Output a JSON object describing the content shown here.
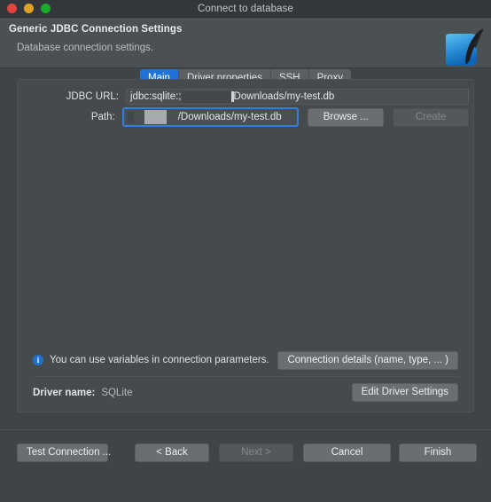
{
  "window": {
    "title": "Connect to database",
    "traffic_lights": [
      "close-red",
      "minimize-yellow",
      "zoom-green"
    ]
  },
  "header": {
    "title": "Generic JDBC Connection Settings",
    "subtitle": "Database connection settings.",
    "logo_icon": "sqlite-logo-icon"
  },
  "tabs": [
    {
      "label": "Main",
      "active": true
    },
    {
      "label": "Driver properties",
      "active": false
    },
    {
      "label": "SSH",
      "active": false
    },
    {
      "label": "Proxy",
      "active": false
    }
  ],
  "form": {
    "jdbc_url": {
      "label": "JDBC URL:",
      "value_prefix": "jdbc:sqlite:;",
      "value_suffix": "Downloads/my-test.db",
      "redacted": true
    },
    "path": {
      "label": "Path:",
      "value_suffix": "/Downloads/my-test.db",
      "redacted": true,
      "focused": true
    },
    "browse_button": "Browse ...",
    "create_button": "Create",
    "create_disabled": true
  },
  "info": {
    "icon": "info-circle-icon",
    "text": "You can use variables in connection parameters.",
    "connection_details_button": "Connection details (name, type, ... )"
  },
  "driver": {
    "label": "Driver name:",
    "value": "SQLite",
    "edit_button": "Edit Driver Settings"
  },
  "footer": {
    "test_connection": "Test Connection ...",
    "back": "< Back",
    "next": "Next >",
    "next_disabled": true,
    "cancel": "Cancel",
    "finish": "Finish"
  },
  "colors": {
    "accent": "#1f72d8",
    "window_bg": "#3f4447",
    "header_bg": "#4b5053",
    "panel_bg": "#454a4d",
    "titlebar_bg": "#33363a"
  }
}
